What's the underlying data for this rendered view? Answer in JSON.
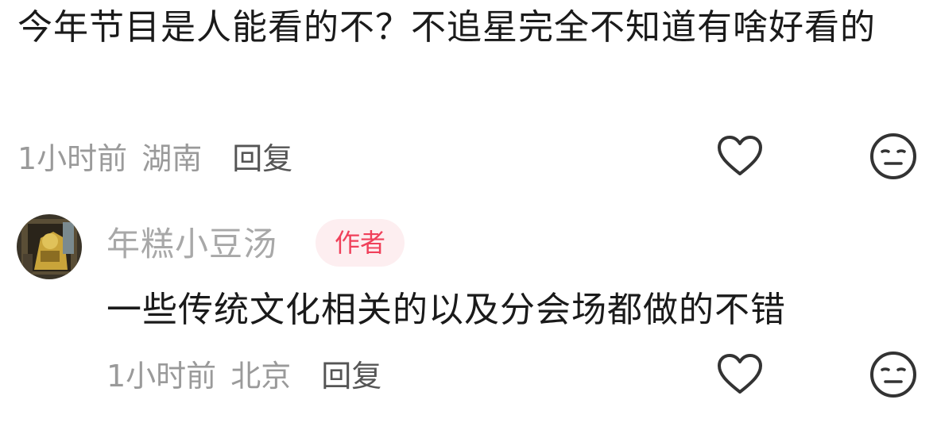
{
  "comment1": {
    "text": "今年节目是人能看的不？不追星完全不知道有啥好看的",
    "time": "1小时前",
    "location": "湖南",
    "reply_label": "回复"
  },
  "comment2": {
    "username": "年糕小豆汤",
    "badge": "作者",
    "text": "一些传统文化相关的以及分会场都做的不错",
    "time": "1小时前",
    "location": "北京",
    "reply_label": "回复"
  },
  "icons": {
    "like": "heart-icon",
    "emoji": "neutral-face-icon"
  },
  "colors": {
    "badge_text": "#f0405a",
    "badge_bg": "#fdeef0",
    "meta_text": "#9a9a9a"
  }
}
